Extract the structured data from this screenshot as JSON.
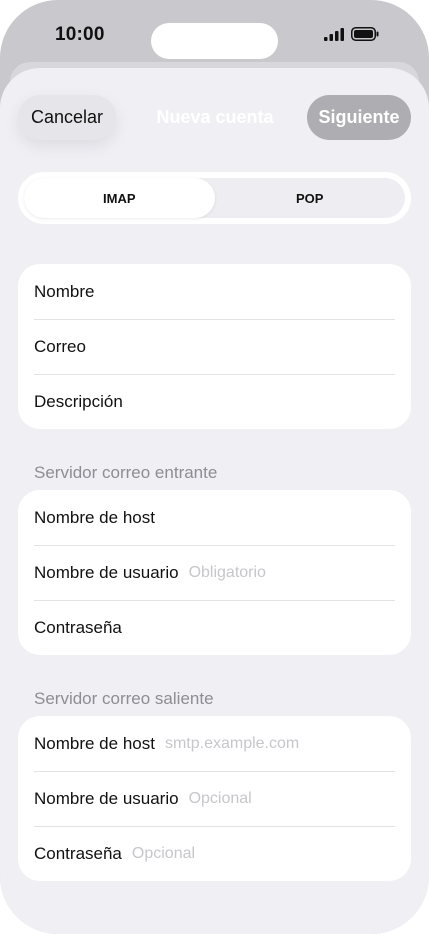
{
  "status": {
    "time": "10:00"
  },
  "nav": {
    "cancel_label": "Cancelar",
    "title": "Nueva cuenta",
    "next_label": "Siguiente"
  },
  "segmented": {
    "options": [
      "IMAP",
      "POP"
    ],
    "selected": "IMAP"
  },
  "account": {
    "rows": [
      {
        "label": "Nombre",
        "placeholder": ""
      },
      {
        "label": "Correo",
        "placeholder": ""
      },
      {
        "label": "Descripción",
        "placeholder": ""
      }
    ]
  },
  "incoming": {
    "header": "Servidor correo entrante",
    "rows": [
      {
        "label": "Nombre de host",
        "placeholder": ""
      },
      {
        "label": "Nombre de usuario",
        "placeholder": "Obligatorio"
      },
      {
        "label": "Contraseña",
        "placeholder": ""
      }
    ]
  },
  "outgoing": {
    "header": "Servidor correo saliente",
    "rows": [
      {
        "label": "Nombre de host",
        "placeholder": "smtp.example.com"
      },
      {
        "label": "Nombre de usuario",
        "placeholder": "Opcional"
      },
      {
        "label": "Contraseña",
        "placeholder": "Opcional"
      }
    ]
  },
  "colors": {
    "background": "#f0eff4",
    "card": "#ffffff",
    "disabled_button": "#aeadb2",
    "placeholder": "#c7c6cb",
    "section_label": "#8e8d92"
  },
  "icons": [
    "cellular-signal-icon",
    "battery-icon"
  ]
}
